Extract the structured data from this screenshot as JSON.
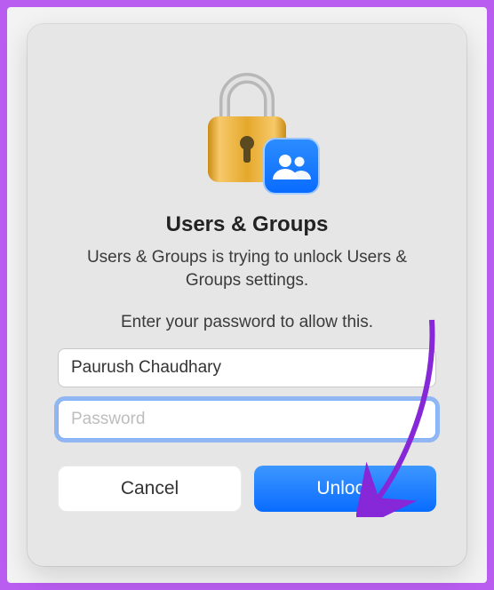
{
  "title": "Users & Groups",
  "subtitle": "Users & Groups is trying to unlock Users & Groups settings.",
  "prompt": "Enter your password to allow this.",
  "username_value": "Paurush Chaudhary",
  "password_placeholder": "Password",
  "cancel_label": "Cancel",
  "unlock_label": "Unlock"
}
